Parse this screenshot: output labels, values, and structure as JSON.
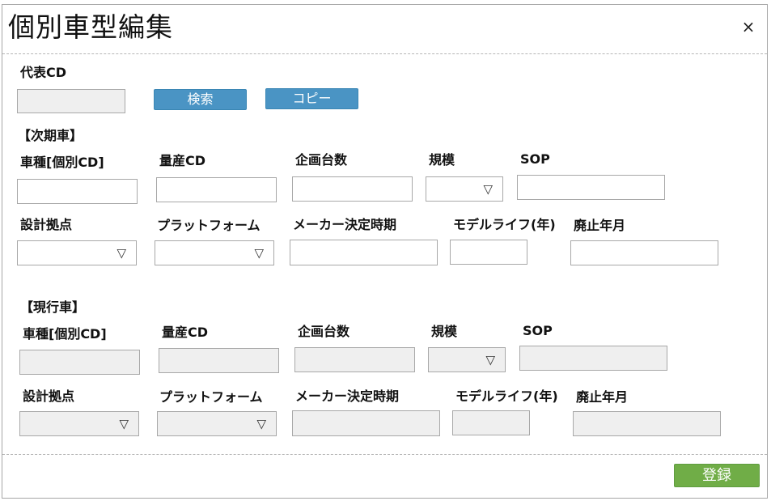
{
  "dialog": {
    "title": "個別車型編集",
    "close_label": "×"
  },
  "search": {
    "code_label": "代表CD",
    "code_value": "",
    "search_button": "検索",
    "copy_button": "コピー"
  },
  "next_vehicle": {
    "section_label": "【次期車】",
    "model_label": "車種[個別CD]",
    "mass_cd_label": "量産CD",
    "planned_units_label": "企画台数",
    "scale_label": "規模",
    "sop_label": "SOP",
    "design_base_label": "設計拠点",
    "platform_label": "プラットフォーム",
    "maker_decision_label": "メーカー決定時期",
    "model_life_label": "モデルライフ(年)",
    "discontinue_label": "廃止年月"
  },
  "current_vehicle": {
    "section_label": "【現行車】",
    "model_label": "車種[個別CD]",
    "mass_cd_label": "量産CD",
    "planned_units_label": "企画台数",
    "scale_label": "規模",
    "sop_label": "SOP",
    "design_base_label": "設計拠点",
    "platform_label": "プラットフォーム",
    "maker_decision_label": "メーカー決定時期",
    "model_life_label": "モデルライフ(年)",
    "discontinue_label": "廃止年月"
  },
  "dropdown_glyph": "▽",
  "footer": {
    "register_button": "登録"
  },
  "colors": {
    "primary_button": "#4a94c4",
    "register_button": "#70ad47",
    "disabled_field": "#efefef",
    "border": "#a8a8a8"
  }
}
